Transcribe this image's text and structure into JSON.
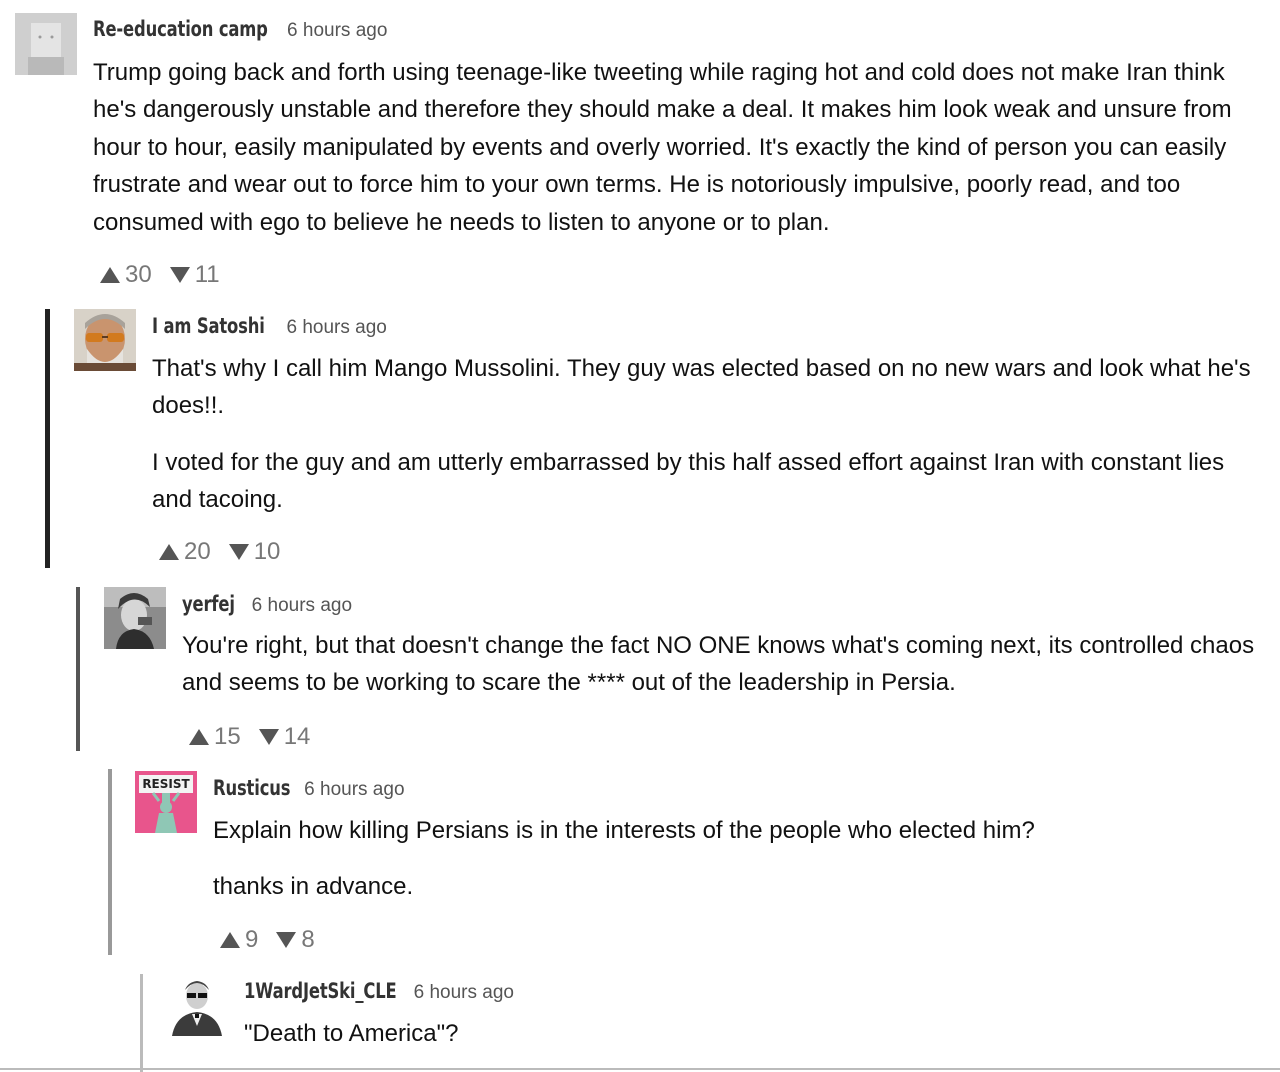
{
  "comments": [
    {
      "username": "Re-education camp",
      "timestamp": "6 hours ago",
      "paragraphs": [
        "Trump going back and forth using teenage-like tweeting while raging hot and cold does not make Iran think he's dangerously unstable and therefore they should make a deal. It makes him look weak and unsure from hour to hour, easily manipulated by events and overly worried. It's exactly the kind of person you can easily frustrate and wear out to force him to your own terms. He is notoriously impulsive, poorly read, and too consumed with ego to believe he needs to listen to anyone or to plan."
      ],
      "upvotes": "30",
      "downvotes": "11",
      "avatar_icon": "blank-profile-avatar"
    },
    {
      "username": "I am Satoshi",
      "timestamp": "6 hours ago",
      "paragraphs": [
        "That's why I call him Mango Mussolini. They guy was elected based on no new wars and look what he's does!!.",
        "I voted for the guy and am utterly embarrassed by this half assed effort against Iran with constant lies and tacoing."
      ],
      "upvotes": "20",
      "downvotes": "10",
      "avatar_icon": "man-with-sunglasses-avatar"
    },
    {
      "username": "yerfej",
      "timestamp": "6 hours ago",
      "paragraphs": [
        "You're right, but that doesn't change the fact NO ONE knows what's coming next, its controlled chaos and seems to be working to scare the **** out of the leadership in Persia."
      ],
      "upvotes": "15",
      "downvotes": "14",
      "avatar_icon": "grayscale-portrait-avatar"
    },
    {
      "username": "Rusticus",
      "timestamp": "6 hours ago",
      "paragraphs": [
        "Explain how killing Persians is in the interests of the people who elected him?",
        "thanks in advance."
      ],
      "upvotes": "9",
      "downvotes": "8",
      "avatar_icon": "resist-statue-avatar",
      "avatar_text": "RESIST"
    },
    {
      "username": "1WardJetSki_CLE",
      "timestamp": "6 hours ago",
      "paragraphs": [
        "\"Death to America\"?"
      ],
      "avatar_icon": "man-with-sunglasses-suit-avatar"
    }
  ],
  "colors": {
    "thread_bar_level1": "#222222",
    "thread_bar_level2": "#555555",
    "thread_bar_level3": "#999999",
    "thread_bar_level4": "#bbbbbb",
    "vote_icon": "#555555",
    "vote_count": "#777777",
    "resist_pink": "#e8558c"
  }
}
